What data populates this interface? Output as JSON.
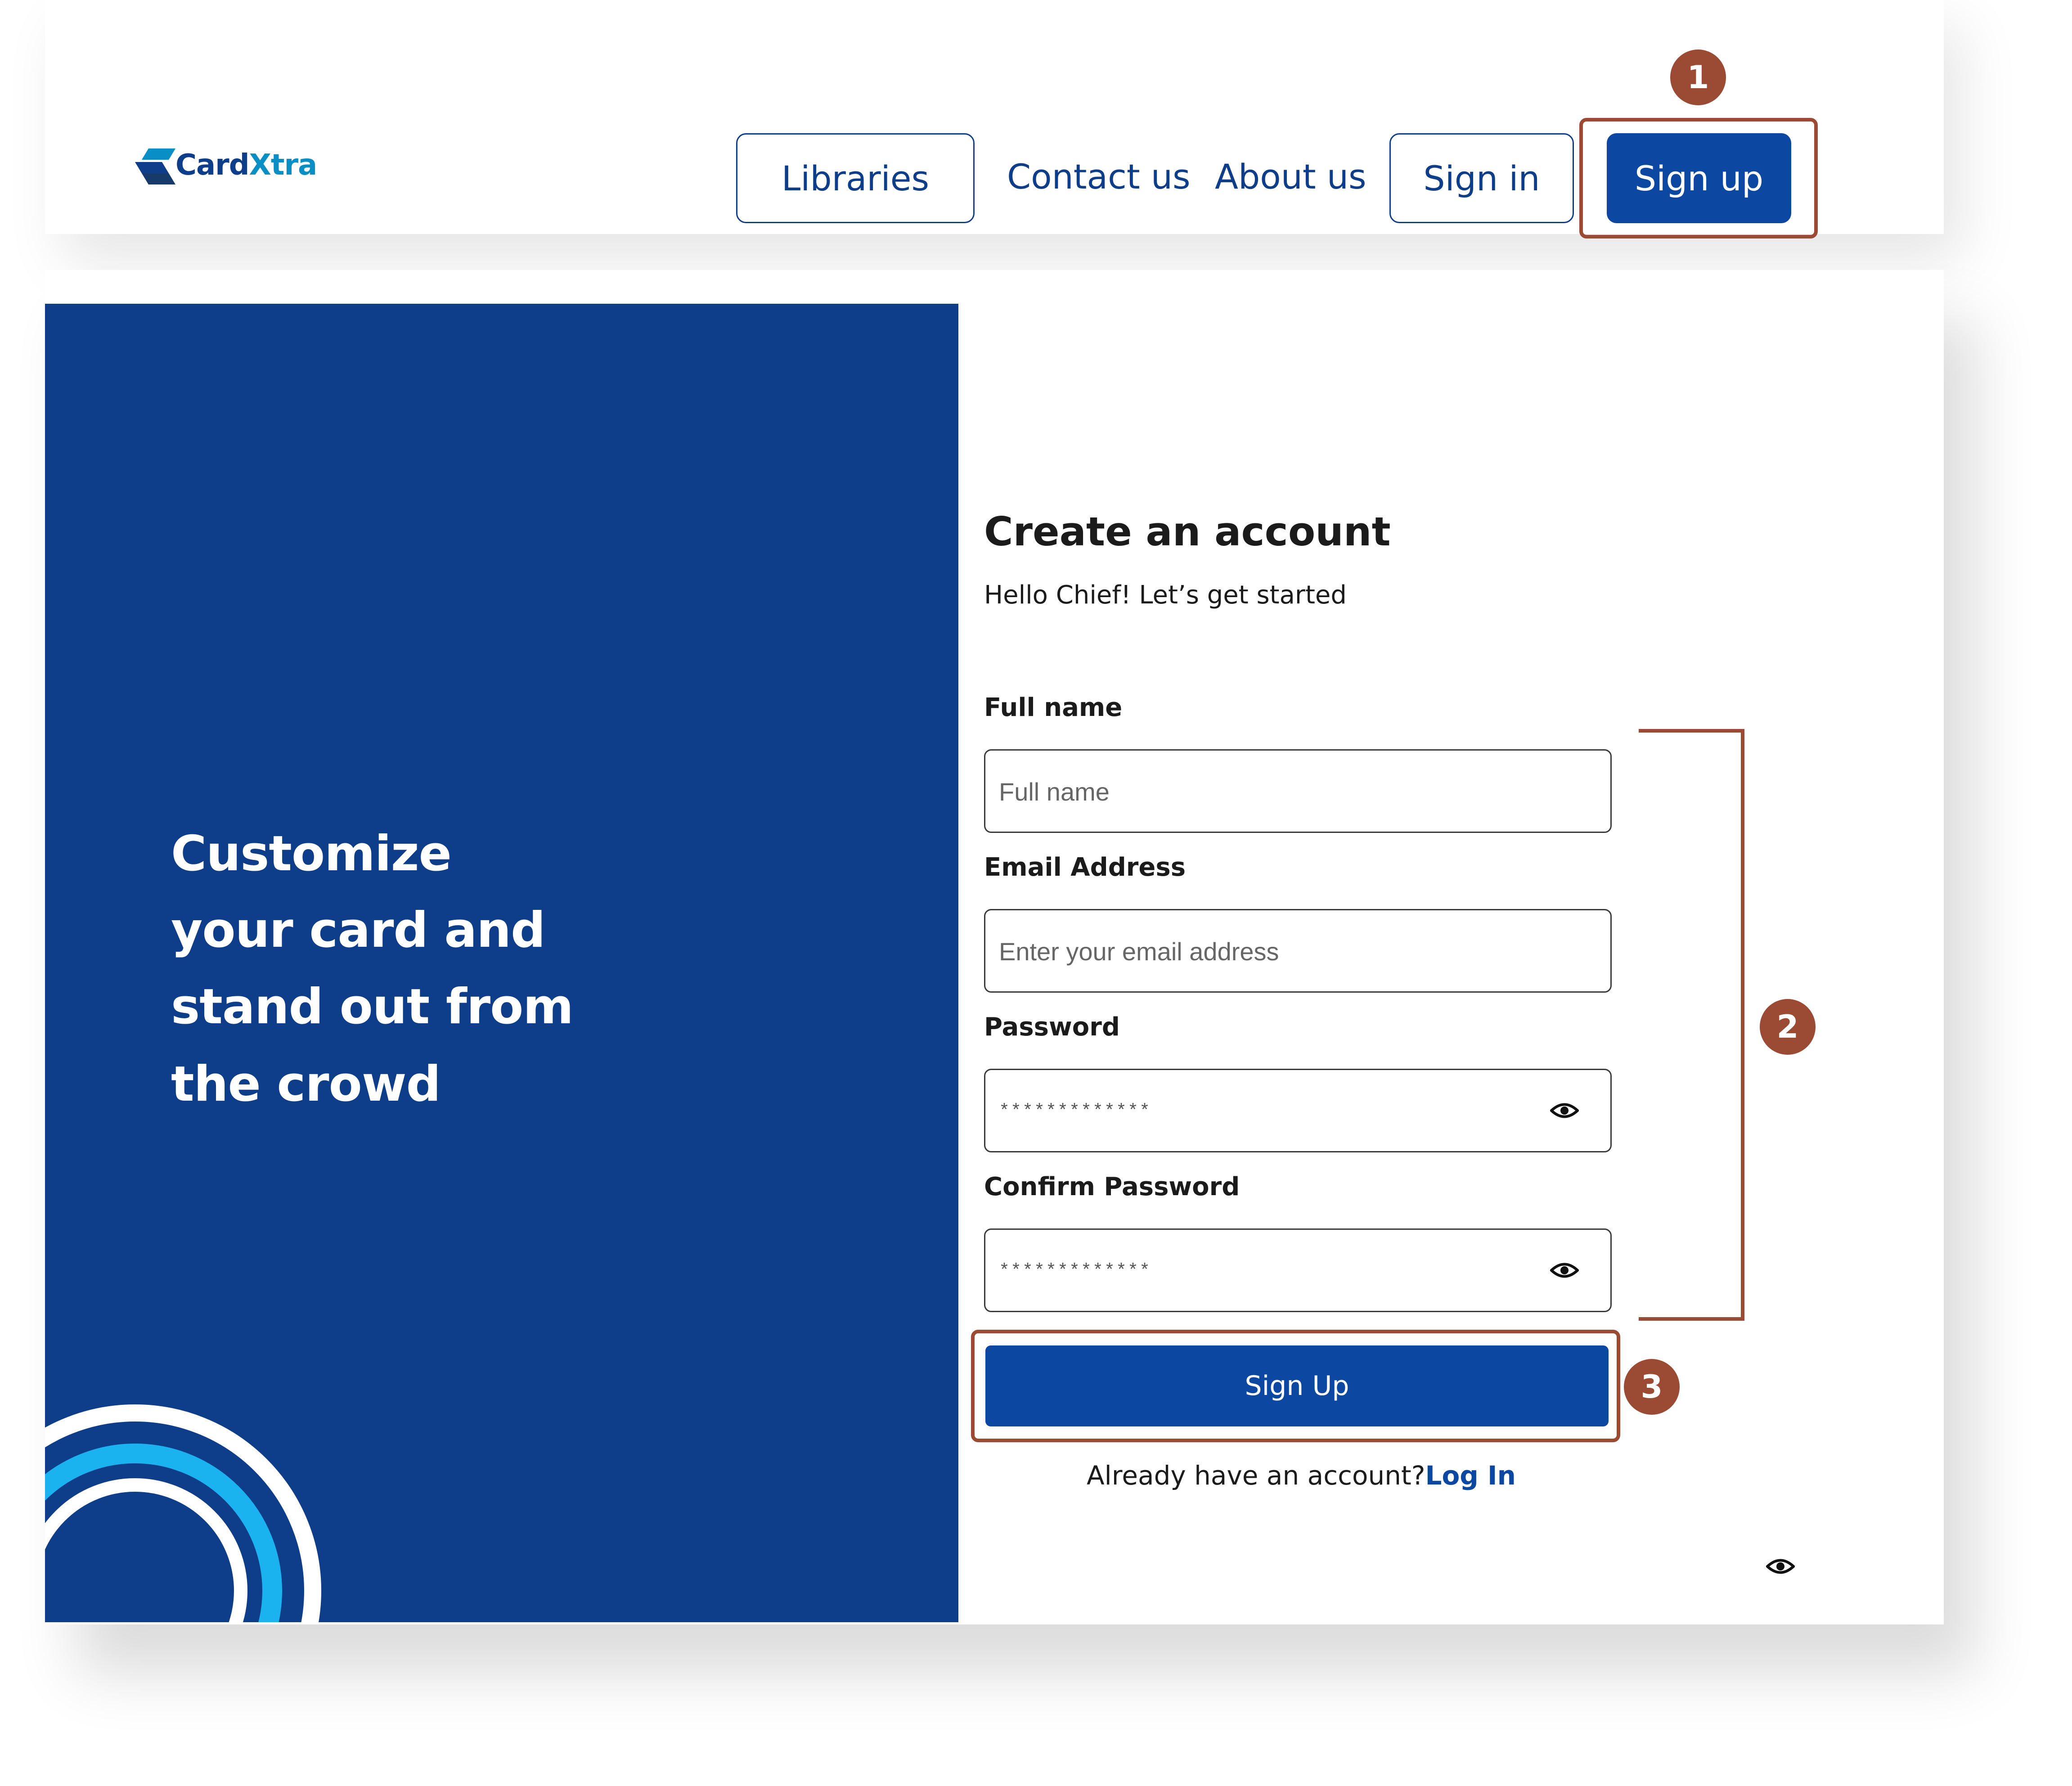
{
  "brand": {
    "name_part1": "Card",
    "name_part2": "Xtra"
  },
  "nav": {
    "libraries": "Libraries",
    "contact": "Contact us",
    "about": "About us",
    "signin": "Sign in",
    "signup": "Sign up"
  },
  "hero": {
    "lines": [
      "Customize",
      "your card and",
      "stand out from",
      "the crowd"
    ]
  },
  "form": {
    "title": "Create an account",
    "subtitle": "Hello Chief! Let’s get started",
    "fullname": {
      "label": "Full name",
      "placeholder": "Full name"
    },
    "email": {
      "label": "Email Address",
      "placeholder": "Enter your email address"
    },
    "password": {
      "label": "Password",
      "value": "*************"
    },
    "confirm": {
      "label": "Confirm Password",
      "value": "*************"
    },
    "submit": "Sign Up",
    "already_text": "Already have an account?",
    "login_link": "Log In"
  },
  "annotations": {
    "one": "1",
    "two": "2",
    "three": "3"
  },
  "colors": {
    "primary": "#0c47a1",
    "hero_bg": "#0e3d8a",
    "accent_cyan": "#1ab3f0",
    "annotation": "#9b4a33"
  },
  "icons": {
    "password_toggle": "eye-icon",
    "logo_mark": "cardxtra-logo-icon"
  }
}
